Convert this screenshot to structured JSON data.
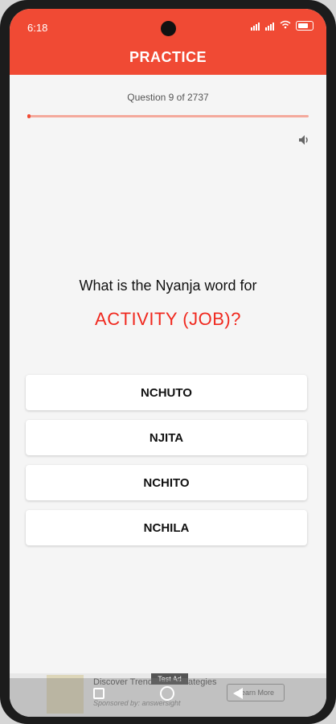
{
  "status_bar": {
    "time": "6:18",
    "battery": "87"
  },
  "header": {
    "title": "PRACTICE"
  },
  "quiz": {
    "counter": "Question 9 of 2737",
    "progress_fraction": 0.0033,
    "question": "What is the Nyanja word for",
    "word": "ACTIVITY (JOB)?",
    "options": [
      "NCHUTO",
      "NJITA",
      "NCHITO",
      "NCHILA"
    ]
  },
  "ad": {
    "label": "Test Ad",
    "title": "Discover Trends and Strategies",
    "sponsor": "Sponsored by: answersight",
    "cta": "Learn More"
  },
  "colors": {
    "accent": "#f04a34",
    "word": "#f0281e",
    "background": "#f5f5f5"
  },
  "icons": [
    "speaker-icon",
    "wifi-icon",
    "battery-icon",
    "signal-icon"
  ]
}
